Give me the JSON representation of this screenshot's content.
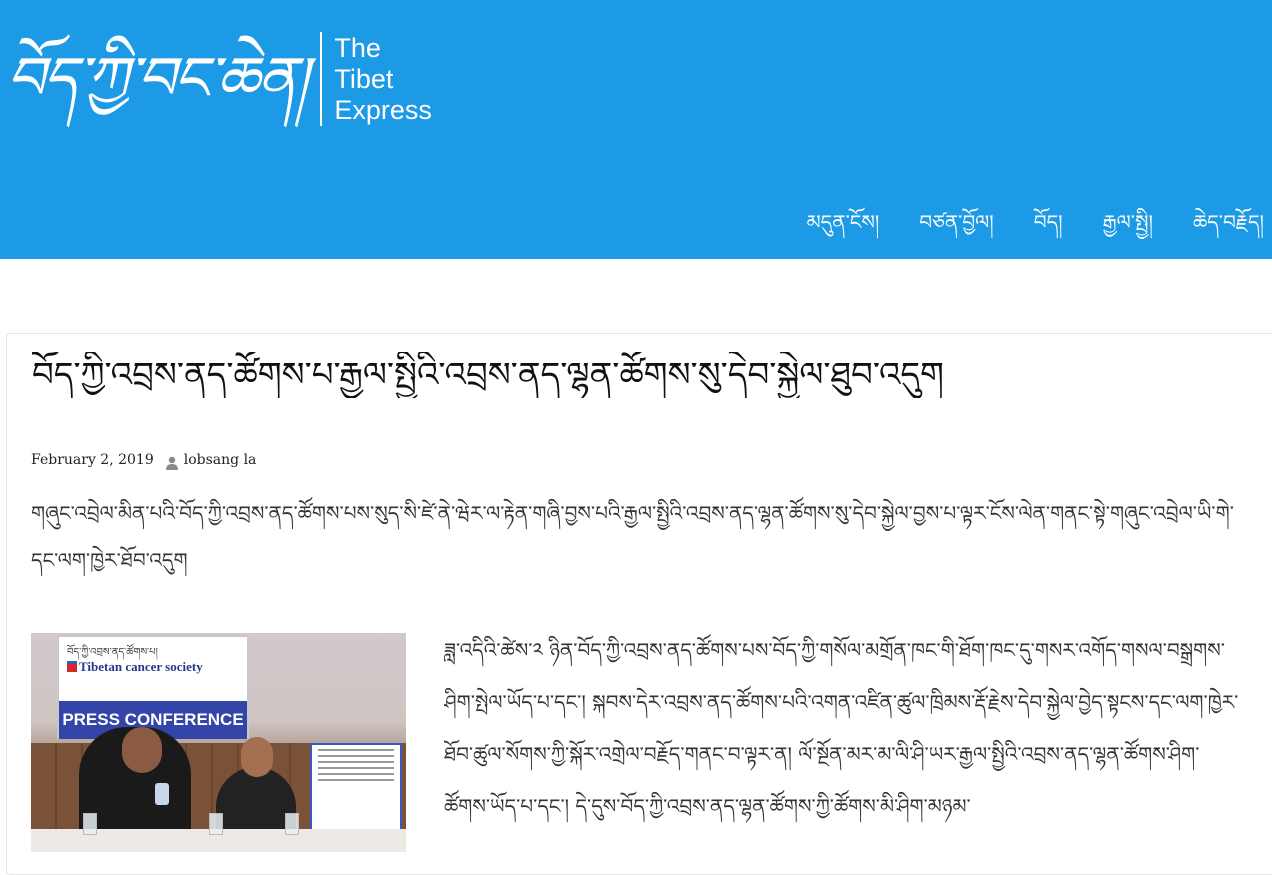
{
  "site": {
    "logo_tibetan": "བོད་ཀྱི་བང་ཆེན།",
    "logo_en": [
      "The",
      "Tibet",
      "Express"
    ]
  },
  "nav": {
    "items": [
      {
        "label": "མདུན་ངོས།"
      },
      {
        "label": "བཙན་བྱོལ།"
      },
      {
        "label": "བོད།"
      },
      {
        "label": "རྒྱལ་སྤྱི།"
      },
      {
        "label": "ཆེད་བརྗོད།"
      }
    ]
  },
  "article": {
    "title": "བོད་ཀྱི་འབྲས་ནད་ཚོགས་པ་རྒྱལ་སྤྱིའི་འབྲས་ནད་ལྷན་ཚོགས་སུ་དེབ་སྐྱེལ་ཐུབ་འདུག",
    "date": "February 2, 2019",
    "author": "lobsang la",
    "excerpt": "གཞུང་འབྲེལ་མིན་པའི་བོད་ཀྱི་འབྲས་ནད་ཚོགས་པས་སུད་སི་ཛེ་ནེ་ཝེར་ལ་རྟེན་གཞི་བྱས་པའི་རྒྱལ་སྤྱིའི་འབྲས་ནད་ལྷན་ཚོགས་སུ་དེབ་སྐྱེལ་བྱས་པ་ལྟར་ངོས་ལེན་གནང་སྟེ་གཞུང་འབྲེལ་ཡི་གེ་དང་ལག་ཁྱེར་ཐོབ་འདུག",
    "body": "ཟླ་འདིའི་ཚེས་༢ ཉིན་བོད་ཀྱི་འབྲས་ནད་ཚོགས་པས་བོད་ཀྱི་གསོལ་མགྲོན་ཁང་གི་ཐོག་ཁང་དུ་གསར་འགོད་གསལ་བསྒྲགས་ཤིག་སྤེལ་ཡོད་པ་དང་། སྐབས་དེར་འབྲས་ནད་ཚོགས་པའི་འགན་འཛིན་ཚུལ་ཁྲིམས་རྡོ་རྗེས་དེབ་སྐྱེལ་བྱེད་སྟངས་དང་ལག་ཁྱེར་ཐོབ་ཚུལ་སོགས་ཀྱི་སྐོར་འགྲེལ་བརྗོད་གནང་བ་ལྟར་ན། ལོ་སྔོན་མར་མ་ལི་ཤི་ཡར་རྒྱལ་སྤྱིའི་འབྲས་ནད་ལྷན་ཚོགས་ཤིག་ཚོགས་ཡོད་པ་དང་། དེ་དུས་བོད་ཀྱི་འབྲས་ནད་ལྷན་ཚོགས་ཀྱི་ཚོགས་མི་ཤིག་མཉམ་"
  },
  "photo": {
    "banner_top": "བོད་ཀྱི་འབྲས་ནད་ཚོགས་པ།",
    "banner_name": "Tibetan cancer society",
    "banner_press": "PRESS CONFERENCE"
  }
}
